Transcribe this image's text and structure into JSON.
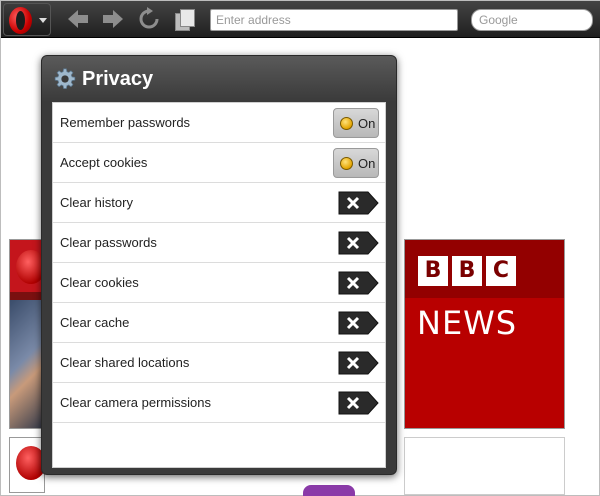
{
  "toolbar": {
    "address_placeholder": "Enter address",
    "search_placeholder": "Google"
  },
  "speed_dial": {
    "bbc_letters": [
      "B",
      "B",
      "C"
    ],
    "bbc_news": "NEWS"
  },
  "panel": {
    "title": "Privacy",
    "toggles": [
      {
        "label": "Remember passwords",
        "state": "On"
      },
      {
        "label": "Accept cookies",
        "state": "On"
      }
    ],
    "actions": [
      {
        "label": "Clear history"
      },
      {
        "label": "Clear passwords"
      },
      {
        "label": "Clear cookies"
      },
      {
        "label": "Clear cache"
      },
      {
        "label": "Clear shared locations"
      },
      {
        "label": "Clear camera permissions"
      }
    ]
  },
  "colors": {
    "toolbar": "#2b2b2b",
    "panel": "#3a3a3a",
    "toggle_indicator": "#e3a400",
    "bbc_red": "#b80000"
  },
  "icons": {
    "menu": "opera-o-icon",
    "back": "arrow-left-icon",
    "forward": "arrow-right-icon",
    "reload": "reload-icon",
    "tabs": "tabs-icon",
    "settings": "gear-icon",
    "clear": "x-icon"
  }
}
